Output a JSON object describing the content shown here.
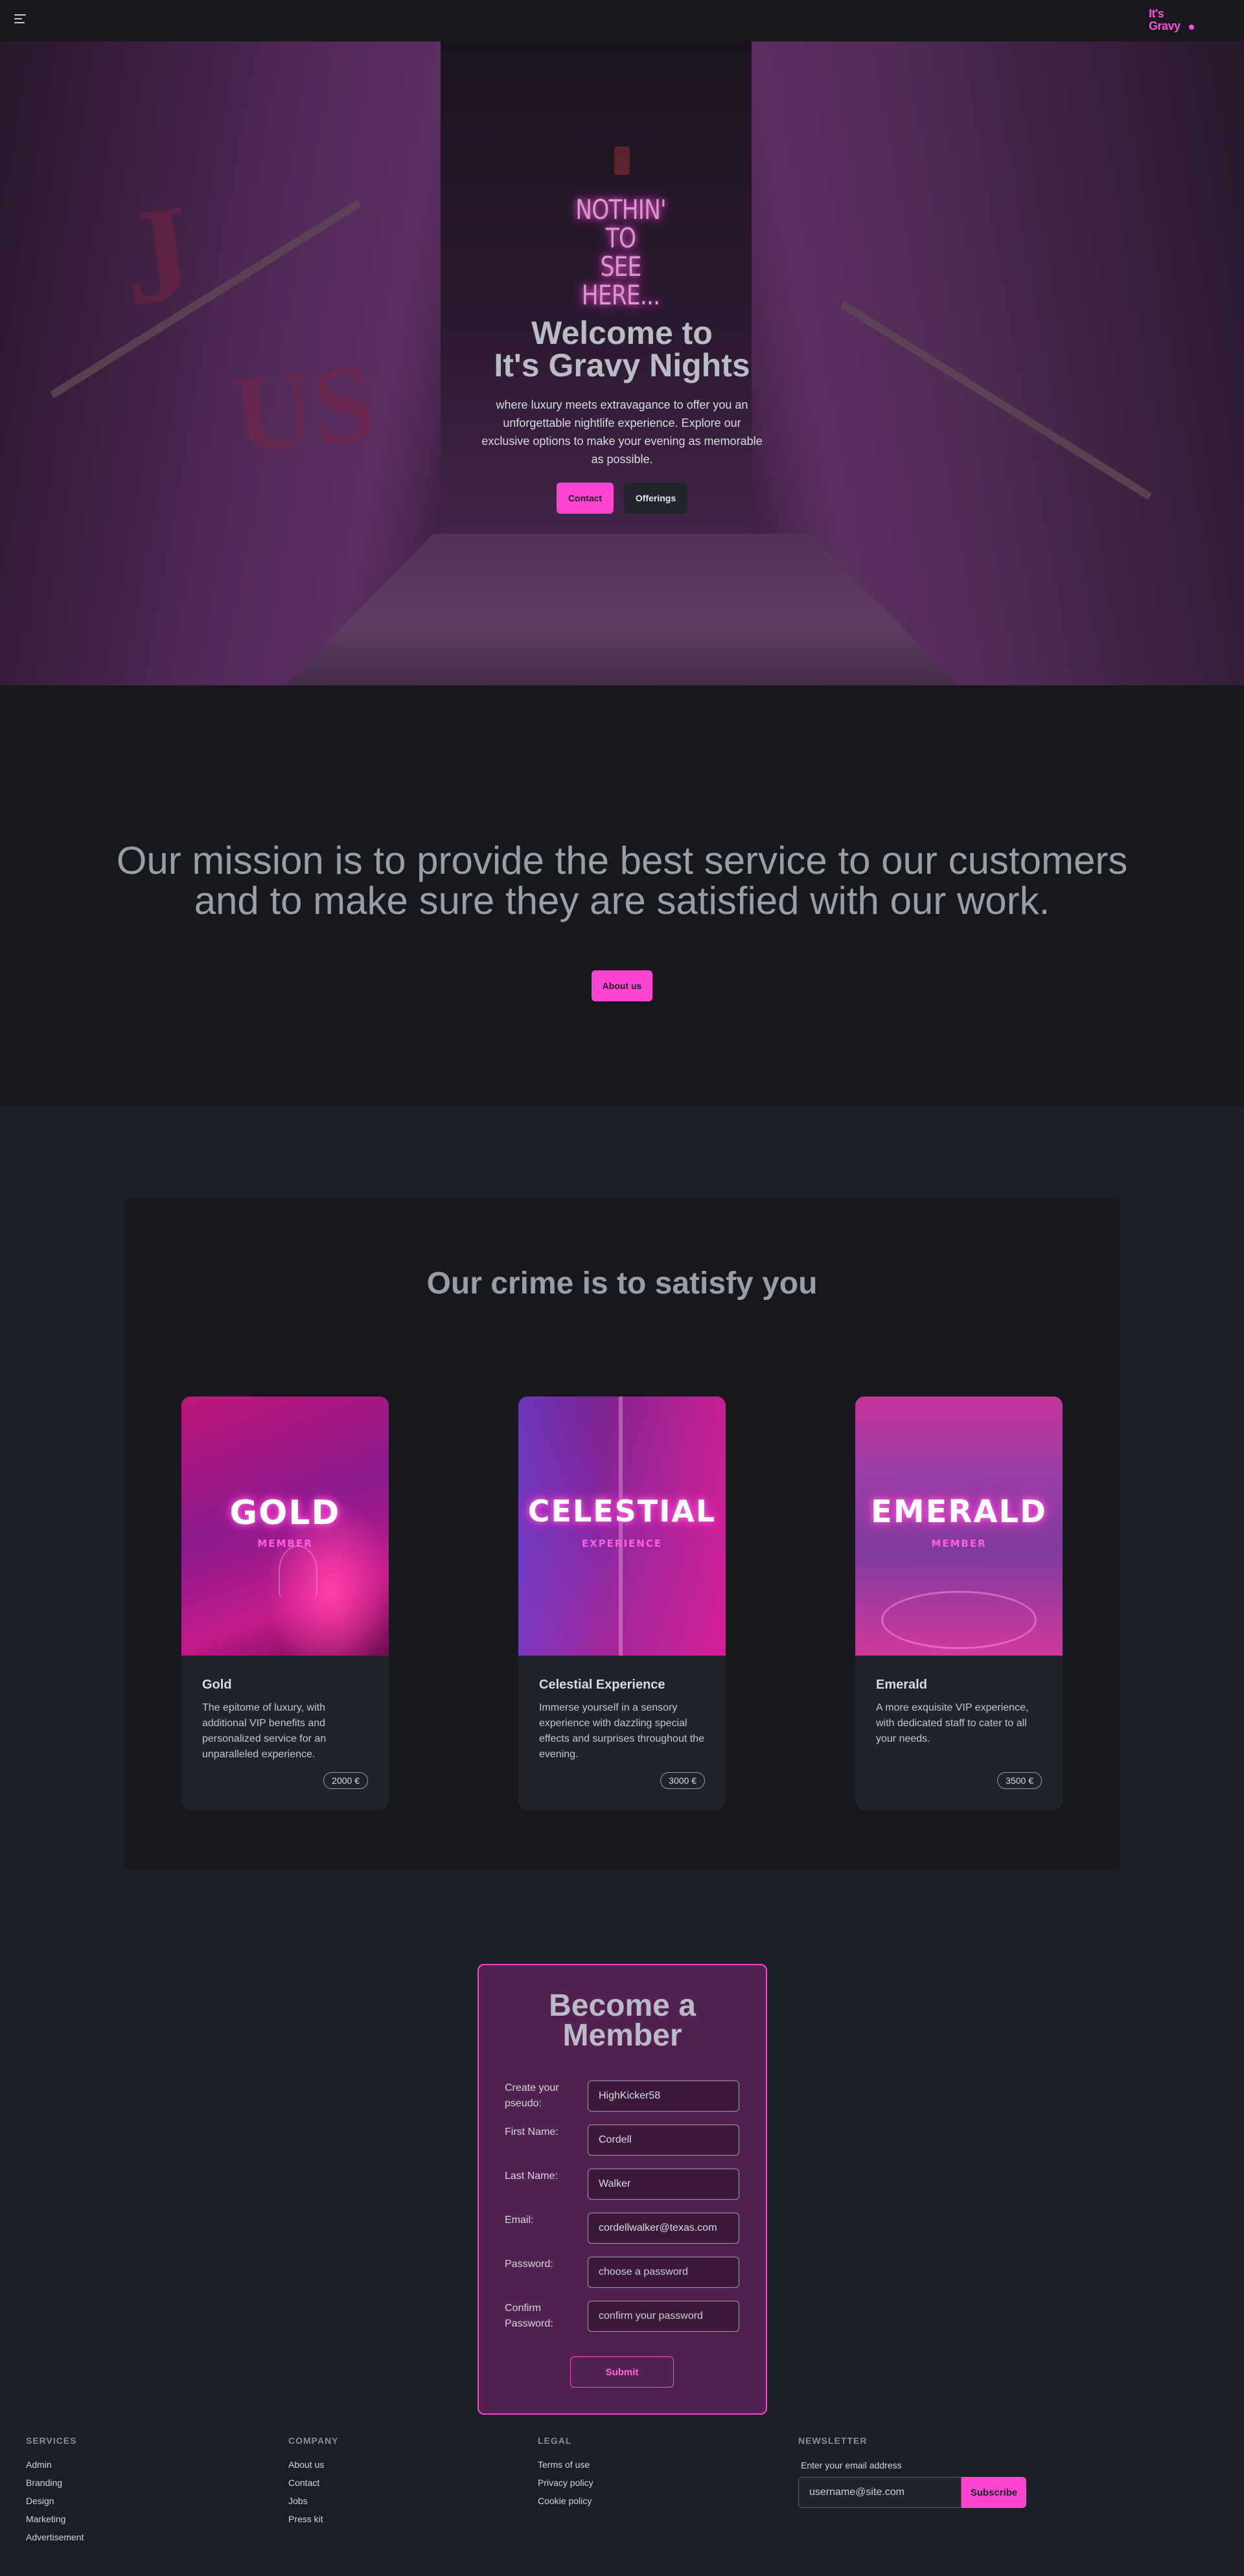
{
  "brand": {
    "line1": "It's",
    "line2": "Gravy"
  },
  "colors": {
    "accent": "#ff44d2",
    "background": "#1b1e25",
    "form_bg": "#51224f"
  },
  "hero": {
    "neon_line1": "NOTHIN' TO",
    "neon_line2": "SEE HERE...",
    "title_line1": "Welcome to",
    "title_line2": "It's Gravy Nights",
    "description": "where luxury meets extravagance to offer you an unforgettable nightlife experience. Explore our exclusive options to make your evening as memorable as possible.",
    "contact_label": "Contact",
    "offerings_label": "Offerings"
  },
  "mission": {
    "text": "Our mission is to provide the best service to our customers and to make sure they are satisfied with our work.",
    "button_label": "About us"
  },
  "offerings": {
    "title": "Our crime is to satisfy you",
    "cards": [
      {
        "image_big": "GOLD",
        "image_small": "MEMBER",
        "name": "Gold",
        "description": "The epitome of luxury, with additional VIP benefits and personalized service for an unparalleled experience.",
        "price": "2000 €"
      },
      {
        "image_big": "CELESTIAL",
        "image_small": "EXPERIENCE",
        "name": "Celestial Experience",
        "description": "Immerse yourself in a sensory experience with dazzling special effects and surprises throughout the evening.",
        "price": "3000 €"
      },
      {
        "image_big": "EMERALD",
        "image_small": "MEMBER",
        "name": "Emerald",
        "description": "A more exquisite VIP experience, with dedicated staff to cater to all your needs.",
        "price": "3500 €"
      }
    ]
  },
  "member_form": {
    "title_line1": "Become a",
    "title_line2": "Member",
    "fields": [
      {
        "label": "Create your pseudo:",
        "value": "HighKicker58",
        "placeholder": ""
      },
      {
        "label": "First Name:",
        "value": "Cordell",
        "placeholder": ""
      },
      {
        "label": "Last Name:",
        "value": "Walker",
        "placeholder": ""
      },
      {
        "label": "Email:",
        "value": "cordellwalker@texas.com",
        "placeholder": ""
      },
      {
        "label": "Password:",
        "value": "",
        "placeholder": "choose a password"
      },
      {
        "label": "Confirm Password:",
        "value": "",
        "placeholder": "confirm your password"
      }
    ],
    "submit_label": "Submit"
  },
  "footer": {
    "services": {
      "heading": "SERVICES",
      "links": [
        "Admin",
        "Branding",
        "Design",
        "Marketing",
        "Advertisement"
      ]
    },
    "company": {
      "heading": "COMPANY",
      "links": [
        "About us",
        "Contact",
        "Jobs",
        "Press kit"
      ]
    },
    "legal": {
      "heading": "LEGAL",
      "links": [
        "Terms of use",
        "Privacy policy",
        "Cookie policy"
      ]
    },
    "newsletter": {
      "heading": "NEWSLETTER",
      "label": "Enter your email address",
      "placeholder": "username@site.com",
      "button_label": "Subscribe"
    }
  }
}
